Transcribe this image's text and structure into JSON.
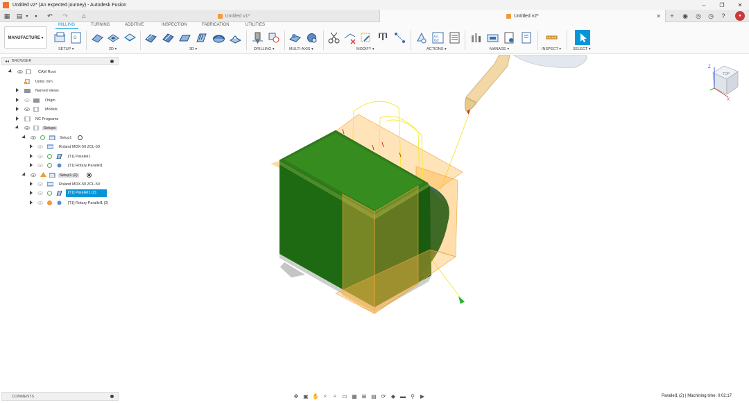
{
  "window": {
    "title": "Untitled v2* (An expected journey) - Autodesk Fusion",
    "controls": [
      "–",
      "❐",
      "✕"
    ]
  },
  "tabs": [
    {
      "label": "Untitled v1*",
      "active": false
    },
    {
      "label": "Untitled v2*",
      "active": true
    }
  ],
  "workspace": {
    "label": "MANUFACTURE ▾"
  },
  "ribbon_tabs": [
    "MILLING",
    "TURNING",
    "ADDITIVE",
    "INSPECTION",
    "FABRICATION",
    "UTILITIES"
  ],
  "groups": [
    "SETUP ▾",
    "2D ▾",
    "3D ▾",
    "DRILLING ▾",
    "MULTI-AXIS ▾",
    "MODIFY ▾",
    "ACTIONS ▾",
    "MANAGE ▾",
    "INSPECT ▾",
    "SELECT ▾"
  ],
  "browser": {
    "title": "BROWSER",
    "items": [
      {
        "label": "CAM Root"
      },
      {
        "label": "Units: mm"
      },
      {
        "label": "Named Views"
      },
      {
        "label": "Origin"
      },
      {
        "label": "Models"
      },
      {
        "label": "NC Programs"
      },
      {
        "label": "Setups"
      },
      {
        "label": "Setup1"
      },
      {
        "label": "Roland MDX-50 ZCL-50"
      },
      {
        "label": "[T1] Parallel1"
      },
      {
        "label": "[T1] Rotary Parallel1"
      },
      {
        "label": "Setup1 (2)"
      },
      {
        "label": "Roland MDX-50 ZCL-50"
      },
      {
        "label": "[T1] Parallel1 (2)"
      },
      {
        "label": "[T1] Rotary Parallel1 (2)"
      }
    ]
  },
  "comments": {
    "title": "COMMENTS"
  },
  "status": {
    "text": "Parallel1 (2) | Machining time: 0:02:17"
  },
  "viewcube": {
    "axis_z": "Z",
    "axis_x": "X",
    "face": "TOP"
  },
  "colors": {
    "accent": "#0696d7",
    "stock": "#ffb547",
    "model": "#2e7d1a",
    "tool": "#f0d6a4"
  }
}
